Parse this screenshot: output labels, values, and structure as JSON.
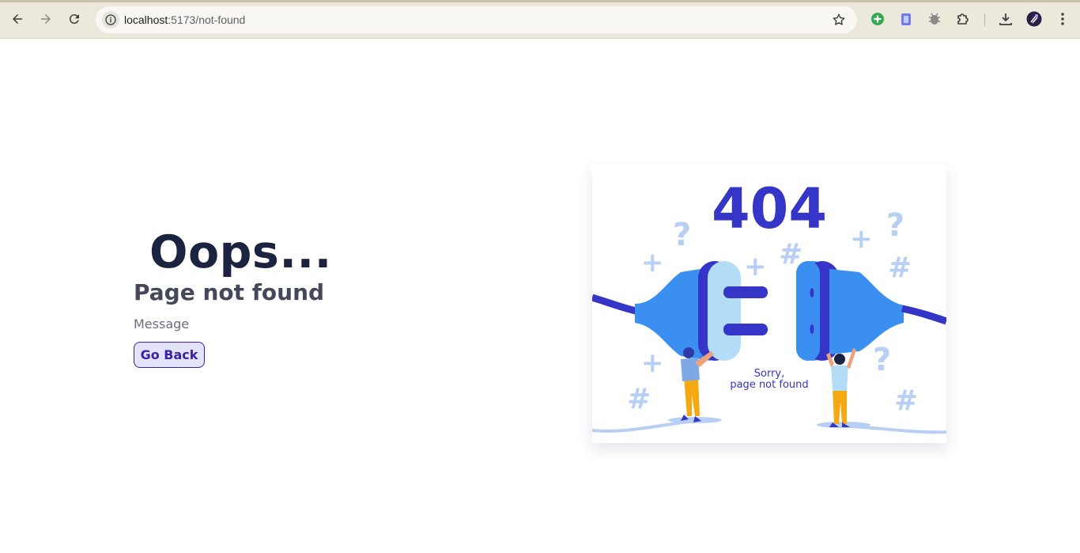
{
  "browser": {
    "url_host": "localhost",
    "url_path": ":5173/not-found",
    "icons": {
      "back": "arrow-left-icon",
      "forward": "arrow-right-icon",
      "reload": "reload-icon",
      "site_info": "info-icon",
      "bookmark": "star-icon",
      "extensions": [
        "plus-circle-icon",
        "clipboard-icon",
        "bug-icon",
        "puzzle-icon"
      ],
      "download": "download-icon",
      "profile": "avatar-icon",
      "menu": "kebab-menu-icon"
    }
  },
  "page": {
    "heading": "Oops...",
    "subheading": "Page not found",
    "message": "Message",
    "go_back_label": "Go Back"
  },
  "illustration": {
    "code": "404",
    "caption_line1": "Sorry,",
    "caption_line2": "page not found"
  },
  "colors": {
    "accent": "#3a1fa8",
    "illustration_dark": "#3535c8",
    "illustration_blue": "#3a8ff0",
    "illustration_light": "#b8cff5"
  }
}
